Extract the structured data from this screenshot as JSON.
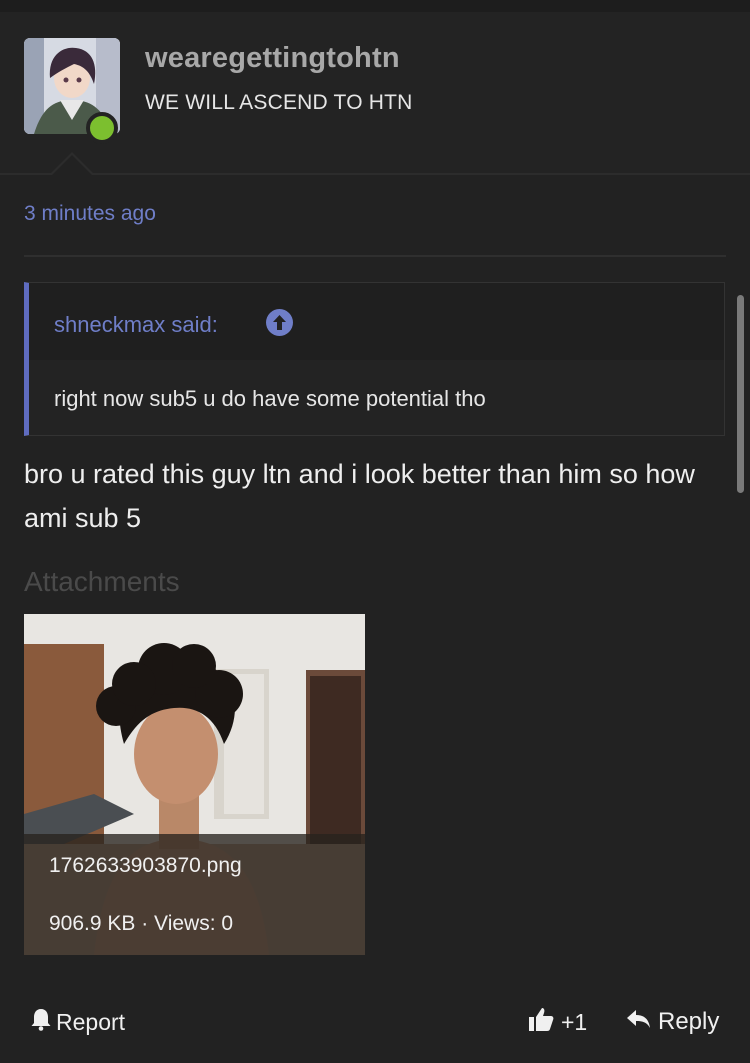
{
  "post": {
    "author": "wearegettingtohtn",
    "user_title": "WE WILL ASCEND TO HTN",
    "timestamp": "3 minutes ago",
    "quote": {
      "author_said": "shneckmax said:",
      "text": "right now sub5 u do have some potential tho"
    },
    "body": "bro u rated this guy ltn and i look better than him so how ami sub 5"
  },
  "attachments": {
    "label": "Attachments",
    "items": [
      {
        "filename": "1762633903870.png",
        "meta": "906.9 KB · Views: 0"
      }
    ]
  },
  "actions": {
    "report": "Report",
    "like_count": "+1",
    "reply": "Reply"
  },
  "colors": {
    "background": "#222222",
    "link": "#6f7ec8",
    "quote_border": "#5f6cc0",
    "online": "#7cbf2f"
  },
  "icons": [
    "upvote-arrow-icon",
    "bell-icon",
    "thumbs-up-icon",
    "reply-arrow-icon"
  ]
}
